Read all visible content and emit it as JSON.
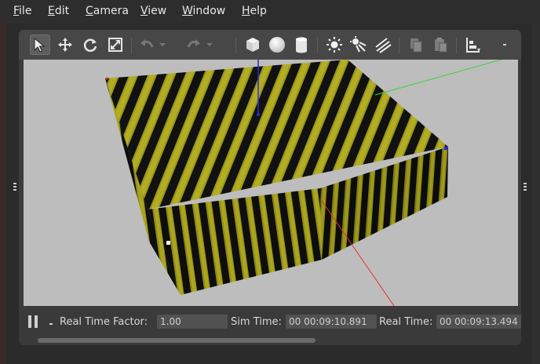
{
  "menu": {
    "items": [
      {
        "label": "File",
        "mnemonic": "F",
        "rest": "ile"
      },
      {
        "label": "Edit",
        "mnemonic": "E",
        "rest": "dit"
      },
      {
        "label": "Camera",
        "mnemonic": "C",
        "rest": "amera"
      },
      {
        "label": "View",
        "mnemonic": "V",
        "rest": "iew"
      },
      {
        "label": "Window",
        "mnemonic": "W",
        "rest": "indow"
      },
      {
        "label": "Help",
        "mnemonic": "H",
        "rest": "elp"
      }
    ]
  },
  "toolbar": {
    "tools": [
      {
        "name": "select-mode-icon",
        "active": true
      },
      {
        "name": "translate-mode-icon"
      },
      {
        "name": "rotate-mode-icon"
      },
      {
        "name": "scale-mode-icon"
      },
      {
        "name": "undo-icon",
        "disabled": true
      },
      {
        "name": "undo-dropdown-icon",
        "disabled": true
      },
      {
        "name": "redo-icon",
        "disabled": true
      },
      {
        "name": "redo-dropdown-icon",
        "disabled": true
      },
      {
        "name": "box-shape-icon"
      },
      {
        "name": "sphere-shape-icon"
      },
      {
        "name": "cylinder-shape-icon"
      },
      {
        "name": "point-light-icon"
      },
      {
        "name": "spot-light-icon"
      },
      {
        "name": "directional-light-icon"
      },
      {
        "name": "copy-icon",
        "disabled": true
      },
      {
        "name": "paste-icon",
        "disabled": true
      },
      {
        "name": "align-icon"
      },
      {
        "name": "overflow-icon"
      }
    ]
  },
  "status": {
    "step_label": ".",
    "real_time_factor_label": "Real Time Factor:",
    "real_time_factor_value": "1.00",
    "sim_time_label": "Sim Time:",
    "sim_time_value": "00 00:09:10.891",
    "real_time_label": "Real Time:",
    "real_time_value": "00 00:09:13.494"
  },
  "colors": {
    "viewport_bg": "#bdbdbd",
    "stripe_yellow": "#a8a41c",
    "stripe_dark": "#111111",
    "axis_x": "#e53030",
    "axis_y": "#3ad23a",
    "axis_z": "#2a2ae0"
  }
}
